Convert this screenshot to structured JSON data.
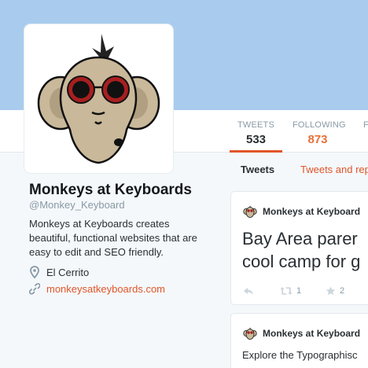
{
  "colors": {
    "banner": "#a9ccee",
    "accent": "#e0552a",
    "following_value": "#e8703a"
  },
  "profile": {
    "name": "Monkeys at Keyboards",
    "handle": "@Monkey_Keyboard",
    "bio": "Monkeys at Keyboards creates beautiful, functional websites that are easy to edit and SEO friendly.",
    "location": "El Cerrito",
    "website": "monkeysatkeyboards.com"
  },
  "stats": [
    {
      "label": "TWEETS",
      "value": "533"
    },
    {
      "label": "FOLLOWING",
      "value": "873"
    },
    {
      "label": "F",
      "value": ""
    }
  ],
  "tabs": {
    "tweets": "Tweets",
    "replies": "Tweets and rep"
  },
  "tweets": [
    {
      "author": "Monkeys at Keyboard",
      "text_line1": "Bay Area parer",
      "text_line2": "cool camp for g",
      "retweets": "1",
      "favorites": "2"
    },
    {
      "author": "Monkeys at Keyboard",
      "text": "Explore the Typographisc"
    }
  ],
  "icons": {
    "location": "map-pin-icon",
    "website": "link-icon",
    "reply": "reply-icon",
    "retweet": "retweet-icon",
    "favorite": "star-icon"
  }
}
